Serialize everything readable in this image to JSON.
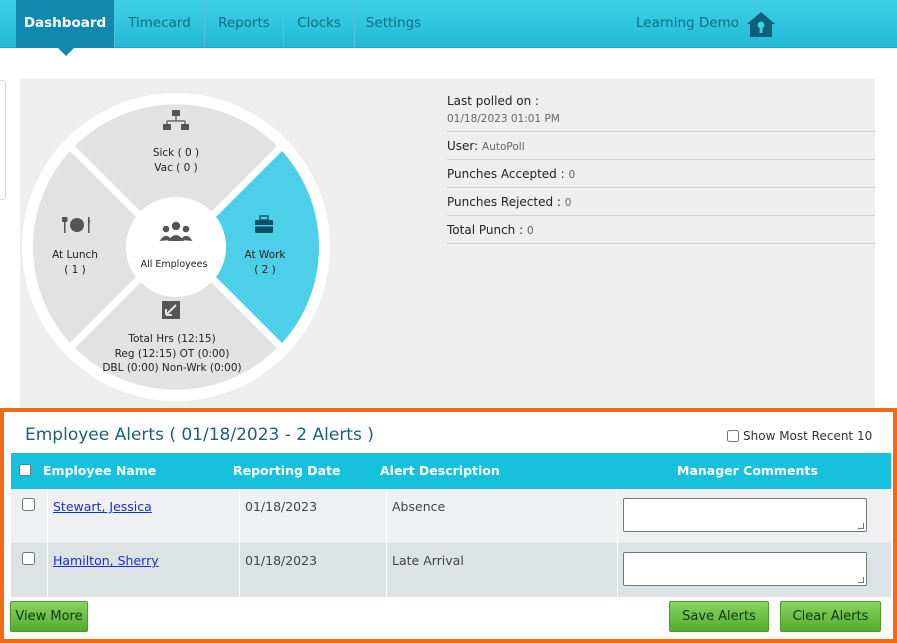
{
  "nav": {
    "tabs": [
      {
        "label": "Dashboard"
      },
      {
        "label": "Timecard"
      },
      {
        "label": "Reports"
      },
      {
        "label": "Clocks"
      },
      {
        "label": "Settings"
      }
    ],
    "account_label": "Learning Demo"
  },
  "wheel": {
    "sick_label": "Sick ( 0 )",
    "vac_label": "Vac ( 0 )",
    "lunch_label": "At Lunch",
    "lunch_count": "( 1 )",
    "work_label": "At Work",
    "work_count": "( 2 )",
    "center_label": "All Employees",
    "hours_line1": "Total Hrs (12:15)",
    "hours_line2": "Reg (12:15) OT (0:00)",
    "hours_line3": "DBL (0:00) Non-Wrk (0:00)",
    "active_color": "#4dcfea",
    "inactive_color": "#e2e2e2"
  },
  "stats": {
    "last_polled_label": "Last polled on :",
    "last_polled_value": "01/18/2023 01:01 PM",
    "user_label": "User:",
    "user_value": "AutoPoll",
    "accepted_label": "Punches Accepted :",
    "accepted_value": "0",
    "rejected_label": "Punches Rejected :",
    "rejected_value": "0",
    "total_label": "Total Punch :",
    "total_value": "0"
  },
  "alerts": {
    "title": "Employee Alerts ( 01/18/2023 - 2 Alerts )",
    "show_recent_label": "Show Most Recent 10",
    "columns": {
      "name": "Employee Name",
      "date": "Reporting Date",
      "description": "Alert Description",
      "comments": "Manager Comments"
    },
    "rows": [
      {
        "name": "Stewart, Jessica",
        "date": "01/18/2023",
        "description": "Absence"
      },
      {
        "name": "Hamilton, Sherry",
        "date": "01/18/2023",
        "description": "Late Arrival"
      }
    ],
    "view_more_label": "View More",
    "save_label": "Save Alerts",
    "clear_label": "Clear Alerts"
  }
}
